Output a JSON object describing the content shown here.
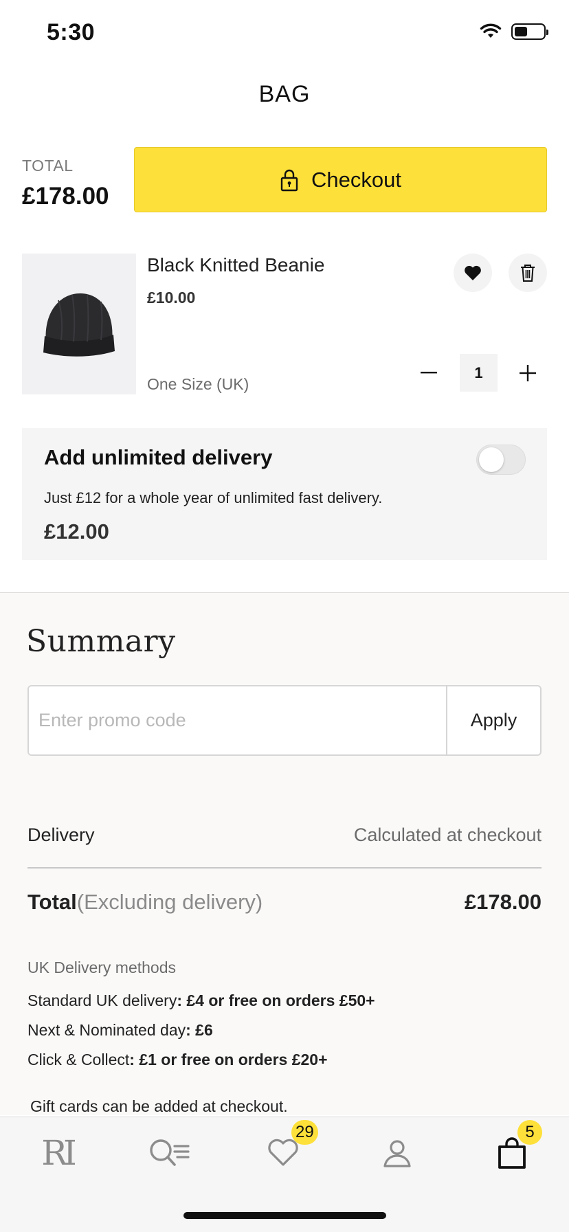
{
  "status_bar": {
    "time": "5:30"
  },
  "header": {
    "title": "BAG"
  },
  "order": {
    "total_label": "TOTAL",
    "total_value": "£178.00",
    "checkout_label": "Checkout"
  },
  "item": {
    "name": "Black Knitted Beanie",
    "price": "£10.00",
    "size": "One Size (UK)",
    "quantity": "1"
  },
  "unlimited_delivery": {
    "title": "Add unlimited delivery",
    "description": "Just £12 for a whole year of unlimited fast delivery.",
    "price": "£12.00",
    "enabled": false
  },
  "summary": {
    "title": "Summary",
    "promo_placeholder": "Enter promo code",
    "apply_label": "Apply",
    "delivery_label": "Delivery",
    "delivery_value": "Calculated at checkout",
    "total_label": "Total",
    "total_note": "(Excluding delivery)",
    "total_value": "£178.00",
    "methods_title": "UK Delivery methods",
    "methods": [
      {
        "name": "Standard UK delivery",
        "detail": ": £4 or free on orders £50+"
      },
      {
        "name": "Next & Nominated day",
        "detail": ": £6"
      },
      {
        "name": "Click & Collect",
        "detail": ": £1 or free on orders £20+"
      }
    ],
    "gift_note": "Gift cards can be added at checkout."
  },
  "tabbar": {
    "home_logo": "RI",
    "wishlist_count": "29",
    "bag_count": "5"
  },
  "colors": {
    "accent": "#fde03a",
    "text": "#111111",
    "muted": "#6b6b6b",
    "card_bg": "#f5f5f5",
    "summary_bg": "#faf9f8"
  },
  "icons": [
    "wifi-icon",
    "battery-icon",
    "lock-icon",
    "heart-icon",
    "trash-icon",
    "minus-icon",
    "plus-icon",
    "search-list-icon",
    "wishlist-icon",
    "account-icon",
    "bag-icon"
  ]
}
